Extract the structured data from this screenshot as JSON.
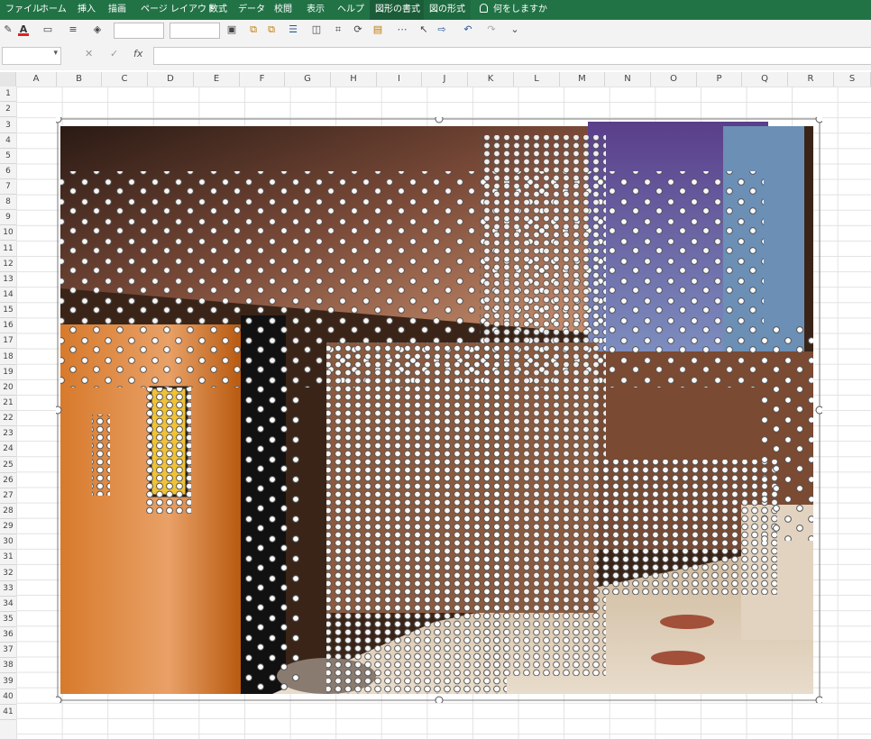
{
  "ribbon": {
    "tabs": [
      "ファイル",
      "ホーム",
      "挿入",
      "描画",
      "ページ レイアウト",
      "数式",
      "データ",
      "校閲",
      "表示",
      "ヘルプ",
      "図形の書式",
      "図の形式"
    ],
    "tell_me": "何をしますか",
    "active_tab": "図形の書式"
  },
  "icons": {
    "toolbar": [
      "brush-icon",
      "font-color-icon",
      "shape-outline-icon",
      "line-style-icon",
      "fill-icon",
      "shadow-icon",
      "group-icon",
      "align-icon",
      "bring-forward-icon",
      "select-icon",
      "undo-icon",
      "redo-icon"
    ]
  },
  "formula_bar": {
    "name_box_value": "",
    "cancel_symbol": "✕",
    "enter_symbol": "✓",
    "fx_label": "fx",
    "formula_value": ""
  },
  "sheet": {
    "columns": [
      "A",
      "B",
      "C",
      "D",
      "E",
      "F",
      "G",
      "H",
      "I",
      "J",
      "K",
      "L",
      "M",
      "N",
      "O",
      "P",
      "Q",
      "R",
      "S"
    ],
    "rows": [
      "1",
      "2",
      "3",
      "4",
      "5",
      "6",
      "7",
      "8",
      "9",
      "10",
      "11",
      "12",
      "13",
      "14",
      "15",
      "16",
      "17",
      "18",
      "19",
      "20",
      "21",
      "22",
      "23",
      "24",
      "25",
      "26",
      "27",
      "28",
      "29",
      "30",
      "31",
      "32",
      "33",
      "34",
      "35",
      "36",
      "37",
      "38",
      "39",
      "40",
      "41"
    ]
  },
  "colors": {
    "ribbon_green": "#217346",
    "accent_active": "#1b5c38"
  }
}
